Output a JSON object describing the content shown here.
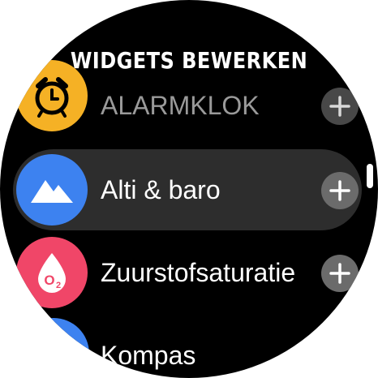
{
  "header": {
    "title": "WIDGETS BEWERKEN"
  },
  "widgets": [
    {
      "label": "ALARMKLOK",
      "icon": "alarm-clock-icon",
      "color": "#f5b125",
      "action_icon": "plus-icon"
    },
    {
      "label": "Alti & baro",
      "icon": "mountain-icon",
      "color": "#3d82f0",
      "action_icon": "plus-icon",
      "selected": true
    },
    {
      "label": "Zuurstofsaturatie",
      "icon": "oxygen-drop-icon",
      "color": "#f04668",
      "icon_text": "O2",
      "action_icon": "plus-icon"
    },
    {
      "label": "Kompas",
      "icon": "compass-icon",
      "color": "#3d82f0"
    }
  ]
}
